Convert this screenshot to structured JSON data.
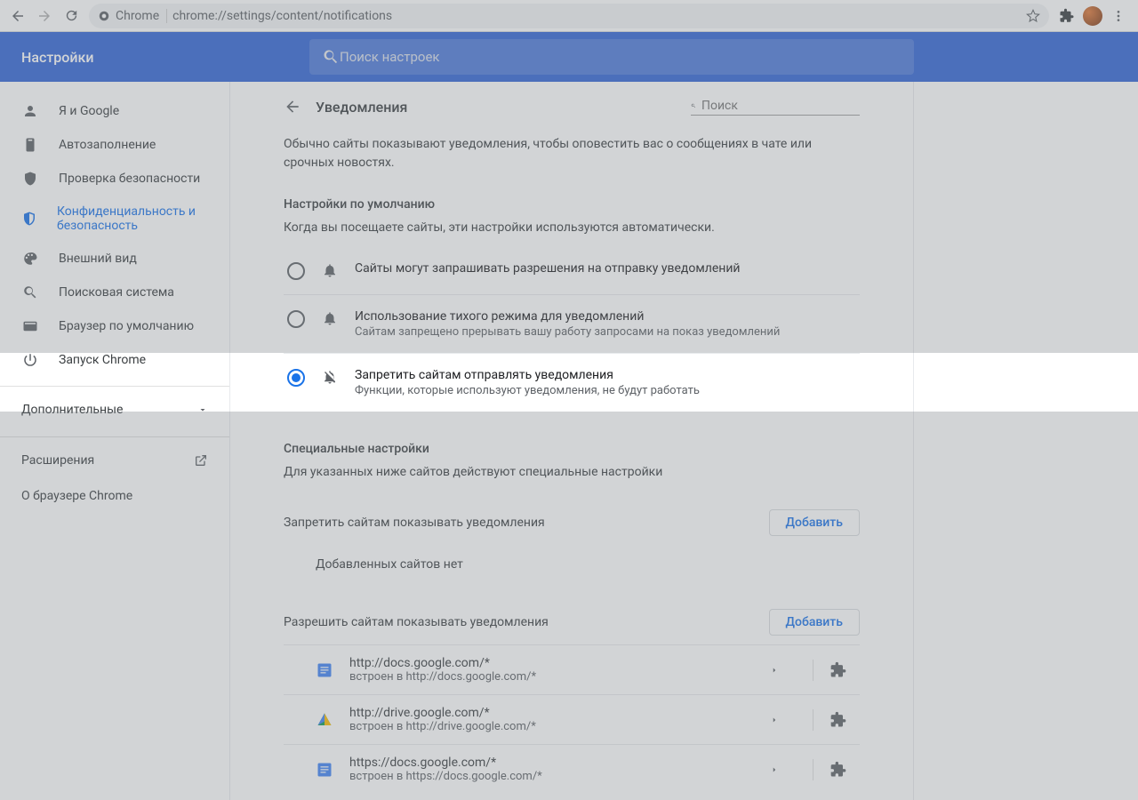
{
  "toolbar": {
    "omnibox_prefix": "Chrome",
    "url": "chrome://settings/content/notifications"
  },
  "header": {
    "title": "Настройки",
    "search_placeholder": "Поиск настроек"
  },
  "sidebar": {
    "items": [
      {
        "label": "Я и Google"
      },
      {
        "label": "Автозаполнение"
      },
      {
        "label": "Проверка безопасности"
      },
      {
        "label": "Конфиденциальность и безопасность"
      },
      {
        "label": "Внешний вид"
      },
      {
        "label": "Поисковая система"
      },
      {
        "label": "Браузер по умолчанию"
      },
      {
        "label": "Запуск Chrome"
      }
    ],
    "more": "Дополнительные",
    "extensions": "Расширения",
    "about": "О браузере Chrome"
  },
  "page": {
    "title": "Уведомления",
    "search_placeholder": "Поиск",
    "description": "Обычно сайты показывают уведомления, чтобы оповестить вас о сообщениях в чате или срочных новостях.",
    "default_title": "Настройки по умолчанию",
    "default_sub": "Когда вы посещаете сайты, эти настройки используются автоматически.",
    "options": [
      {
        "primary": "Сайты могут запрашивать разрешения на отправку уведомлений",
        "secondary": ""
      },
      {
        "primary": "Использование тихого режима для уведомлений",
        "secondary": "Сайтам запрещено прерывать вашу работу запросами на показ уведомлений"
      },
      {
        "primary": "Запретить сайтам отправлять уведомления",
        "secondary": "Функции, которые используют уведомления, не будут работать"
      }
    ],
    "custom_title": "Специальные настройки",
    "custom_sub": "Для указанных ниже сайтов действуют специальные настройки",
    "block_title": "Запретить сайтам показывать уведомления",
    "add_label": "Добавить",
    "empty_label": "Добавленных сайтов нет",
    "allow_title": "Разрешить сайтам показывать уведомления",
    "embedded_prefix": "встроен в ",
    "sites": [
      {
        "url": "http://docs.google.com/*",
        "embed": "http://docs.google.com/*"
      },
      {
        "url": "http://drive.google.com/*",
        "embed": "http://drive.google.com/*"
      },
      {
        "url": "https://docs.google.com/*",
        "embed": "https://docs.google.com/*"
      }
    ]
  }
}
